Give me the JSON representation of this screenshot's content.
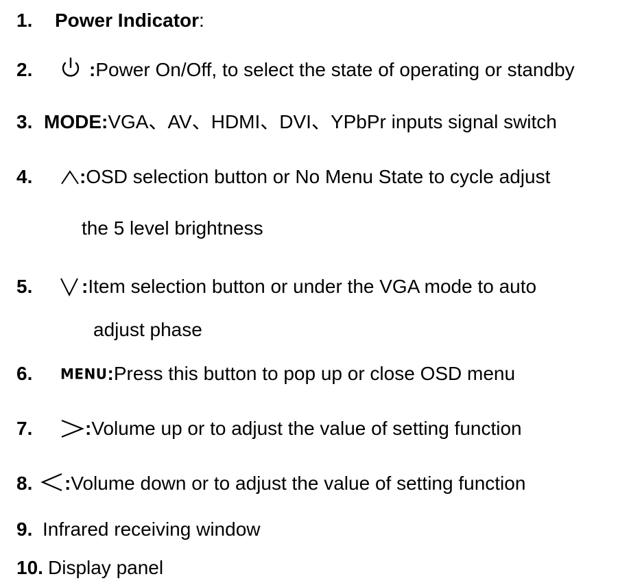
{
  "items": [
    {
      "num": "1.",
      "title": "Power Indicator",
      "colon": ":"
    },
    {
      "num": "2.",
      "icon": "power-icon",
      "colon": ":",
      "text": " Power On/Off, to select the state of operating or standby"
    },
    {
      "num": "3.",
      "label": "MODE",
      "colon": ":",
      "text": " VGA、AV、HDMI、DVI、YPbPr inputs signal switch"
    },
    {
      "num": "4.",
      "icon": "caret-up-icon",
      "colon": ":",
      "text": " OSD selection button or No Menu State to cycle adjust",
      "continuation": "the 5 level brightness"
    },
    {
      "num": "5.",
      "icon": "caret-down-icon",
      "colon": ":",
      "text": " Item selection button or under the VGA mode to auto",
      "continuation": "adjust phase"
    },
    {
      "num": "6.",
      "icon_text": "MENU",
      "colon": ":",
      "text": " Press this button to pop up or close OSD menu"
    },
    {
      "num": "7.",
      "icon": "greater-than-icon",
      "colon": ":",
      "text": " Volume up or to adjust the value of setting function"
    },
    {
      "num": "8.",
      "icon": "less-than-icon",
      "colon": ":",
      "text": " Volume down or to adjust the value of setting function"
    },
    {
      "num": "9.",
      "text": "Infrared receiving window"
    },
    {
      "num": "10.",
      "text": "Display panel"
    }
  ]
}
